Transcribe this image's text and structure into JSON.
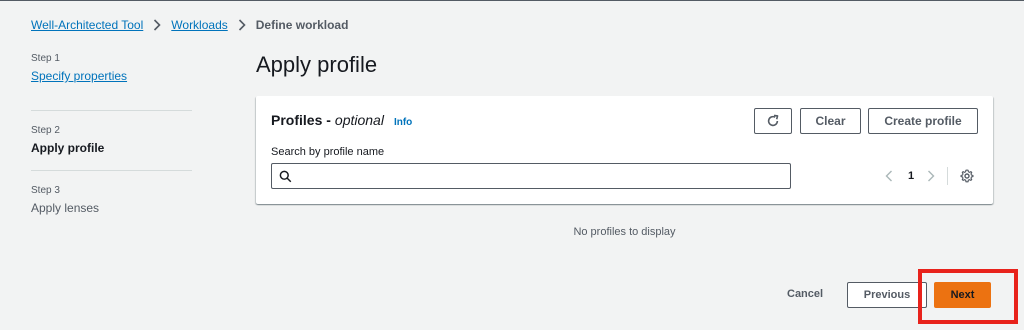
{
  "breadcrumb": {
    "items": [
      {
        "label": "Well-Architected Tool"
      },
      {
        "label": "Workloads"
      }
    ],
    "current": "Define workload"
  },
  "steps": [
    {
      "number": "Step 1",
      "title": "Specify properties",
      "state": "link"
    },
    {
      "number": "Step 2",
      "title": "Apply profile",
      "state": "active"
    },
    {
      "number": "Step 3",
      "title": "Apply lenses",
      "state": "disabled"
    }
  ],
  "page": {
    "title": "Apply profile"
  },
  "profiles_panel": {
    "title": "Profiles -",
    "optional": "optional",
    "info": "Info",
    "refresh_icon": "refresh-icon",
    "clear_label": "Clear",
    "create_label": "Create profile",
    "search_label": "Search by profile name",
    "search_value": "",
    "search_placeholder": "",
    "page_number": "1",
    "empty_message": "No profiles to display"
  },
  "footer": {
    "cancel_label": "Cancel",
    "previous_label": "Previous",
    "next_label": "Next"
  },
  "colors": {
    "link": "#0073bb",
    "primary_button": "#ec7211",
    "highlight_box": "#e8221b",
    "background": "#f2f3f3"
  }
}
